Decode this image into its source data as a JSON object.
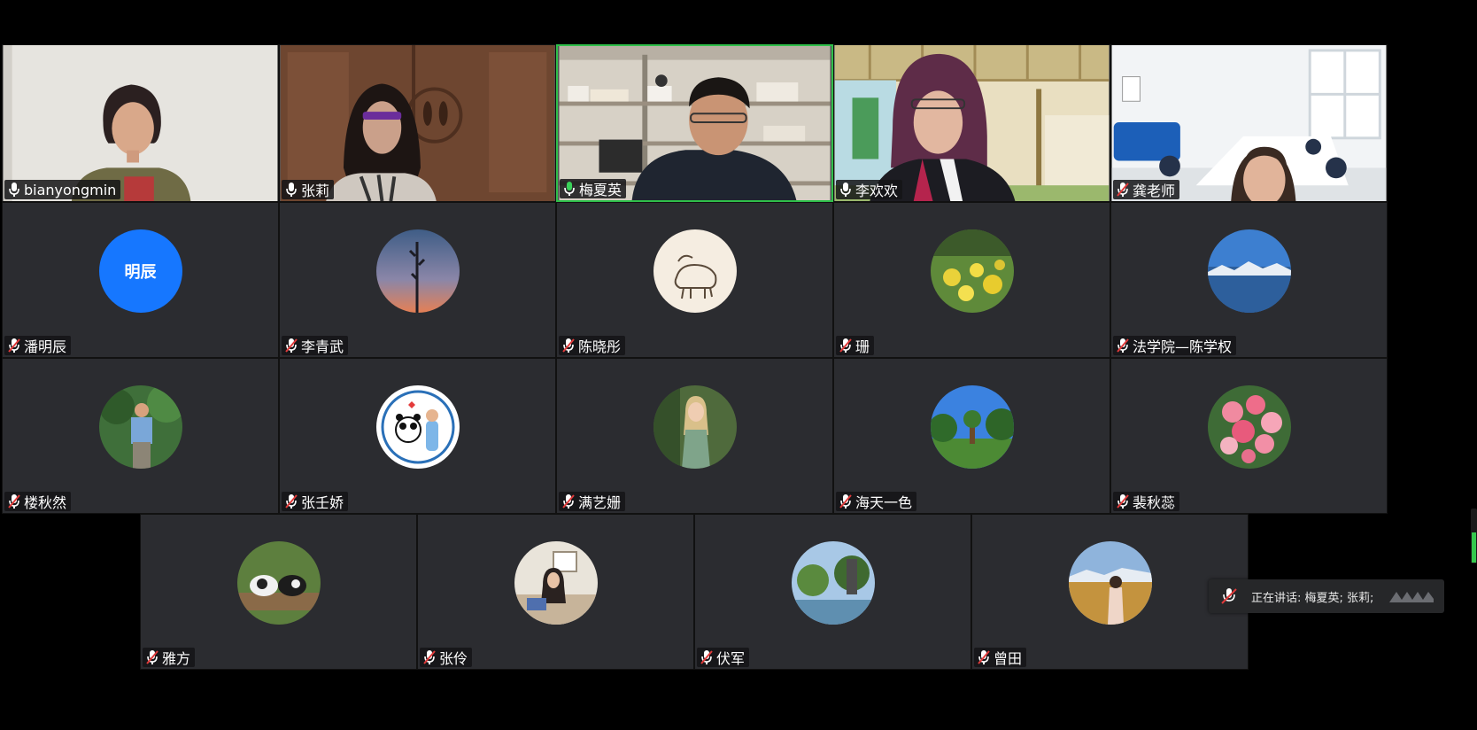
{
  "colors": {
    "tile_bg": "#2b2c30",
    "active_speaker_border": "#2fbf4a",
    "name_tag_bg": "#141416",
    "muted_mic": "#e03a3a",
    "initials_avatar_bg": "#1677ff"
  },
  "participants": [
    {
      "name": "bianyongmin",
      "video": true,
      "muted": false,
      "active": false
    },
    {
      "name": "张莉",
      "video": true,
      "muted": false,
      "active": false
    },
    {
      "name": "梅夏英",
      "video": true,
      "muted": false,
      "active": true
    },
    {
      "name": "李欢欢",
      "video": true,
      "muted": false,
      "active": false
    },
    {
      "name": "龚老师",
      "video": true,
      "muted": false,
      "active": false
    },
    {
      "name": "潘明辰",
      "video": false,
      "muted": true,
      "avatar_initials": "明辰",
      "avatar": "initials"
    },
    {
      "name": "李青武",
      "video": false,
      "muted": true,
      "avatar": "sunset-tree-photo"
    },
    {
      "name": "陈晓彤",
      "video": false,
      "muted": true,
      "avatar": "cartoon-animal-sketch"
    },
    {
      "name": "珊",
      "video": false,
      "muted": true,
      "avatar": "yellow-flower-field-photo"
    },
    {
      "name": "法学院—陈学权",
      "video": false,
      "muted": true,
      "avatar": "lake-mountain-photo"
    },
    {
      "name": "楼秋然",
      "video": false,
      "muted": true,
      "avatar": "man-in-park-photo"
    },
    {
      "name": "张壬娇",
      "video": false,
      "muted": true,
      "avatar": "panda-cartoon"
    },
    {
      "name": "满艺姗",
      "video": false,
      "muted": true,
      "avatar": "woman-garden-photo"
    },
    {
      "name": "海天一色",
      "video": false,
      "muted": true,
      "avatar": "trees-blue-sky-photo"
    },
    {
      "name": "裴秋蕊",
      "video": false,
      "muted": true,
      "avatar": "pink-flower-bouquet-photo"
    },
    {
      "name": "雅方",
      "video": false,
      "muted": true,
      "avatar": "cats-on-log-photo"
    },
    {
      "name": "张伶",
      "video": false,
      "muted": true,
      "avatar": "woman-at-desk-photo"
    },
    {
      "name": "伏军",
      "video": false,
      "muted": true,
      "avatar": "trees-water-photo"
    },
    {
      "name": "曾田",
      "video": false,
      "muted": true,
      "avatar": "woman-in-field-photo"
    }
  ],
  "speaking_indicator": {
    "label": "正在讲话: 梅夏英; 张莉;",
    "icon": "speaker-icon"
  },
  "audio_level": 0.55
}
